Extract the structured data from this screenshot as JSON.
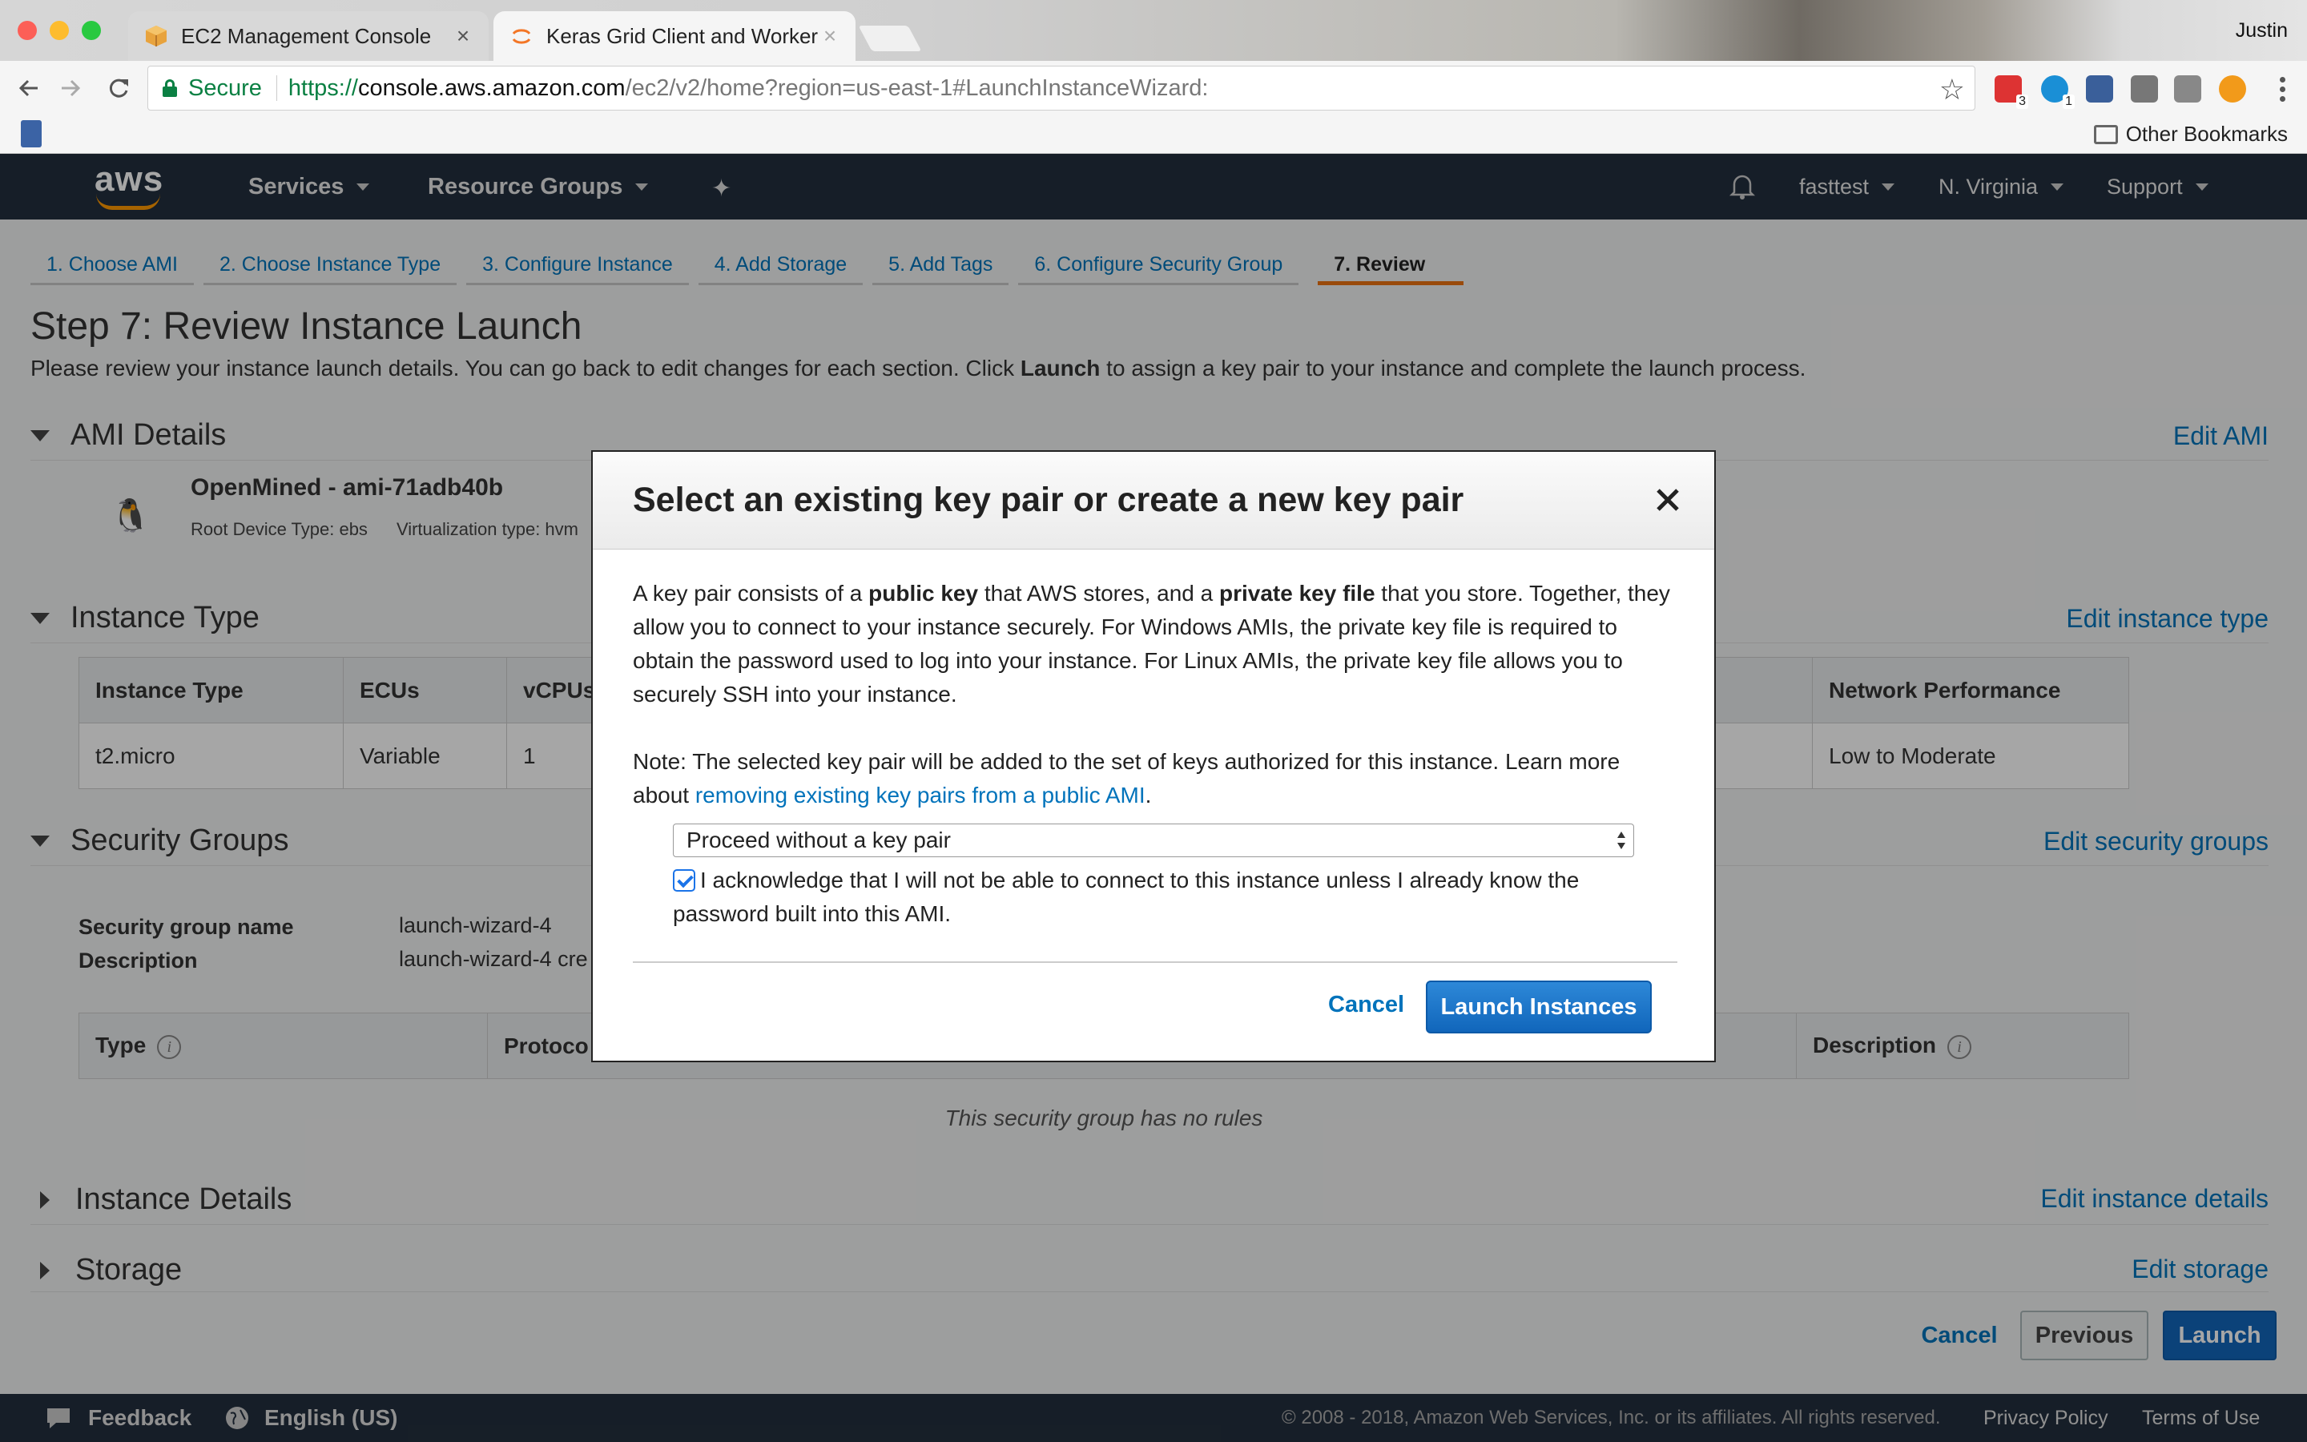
{
  "browser": {
    "tabs": [
      {
        "title": "EC2 Management Console",
        "active": false
      },
      {
        "title": "Keras Grid Client and Worker",
        "active": true
      }
    ],
    "profile_name": "Justin",
    "secure_label": "Secure",
    "url": {
      "scheme": "https://",
      "host": "console.aws.amazon.com",
      "path": "/ec2/v2/home?region=us-east-1#LaunchInstanceWizard:"
    },
    "extension_badges": [
      "3",
      "1"
    ],
    "other_bookmarks": "Other Bookmarks"
  },
  "aws_header": {
    "logo": "aws",
    "services": "Services",
    "resource_groups": "Resource Groups",
    "account": "fasttest",
    "region": "N. Virginia",
    "support": "Support"
  },
  "wizard": {
    "steps": [
      "1. Choose AMI",
      "2. Choose Instance Type",
      "3. Configure Instance",
      "4. Add Storage",
      "5. Add Tags",
      "6. Configure Security Group",
      "7. Review"
    ],
    "active_step": "7. Review",
    "title": "Step 7: Review Instance Launch",
    "description_prefix": "Please review your instance launch details. You can go back to edit changes for each section. Click ",
    "description_bold": "Launch",
    "description_suffix": " to assign a key pair to your instance and complete the launch process."
  },
  "ami_details": {
    "heading": "AMI Details",
    "edit": "Edit AMI",
    "name": "OpenMined - ami-71adb40b",
    "root_device": "Root Device Type: ebs",
    "virtualization": "Virtualization type: hvm"
  },
  "instance_type": {
    "heading": "Instance Type",
    "edit": "Edit instance type",
    "columns": [
      "Instance Type",
      "ECUs",
      "vCPUs",
      "Network Performance"
    ],
    "row": [
      "t2.micro",
      "Variable",
      "1",
      "Low to Moderate"
    ]
  },
  "security_groups": {
    "heading": "Security Groups",
    "edit": "Edit security groups",
    "name_label": "Security group name",
    "name_value": "launch-wizard-4",
    "desc_label": "Description",
    "desc_value": "launch-wizard-4 cre",
    "columns": [
      "Type",
      "Protoco",
      "Description"
    ],
    "empty": "This security group has no rules"
  },
  "instance_details": {
    "heading": "Instance Details",
    "edit": "Edit instance details"
  },
  "storage": {
    "heading": "Storage",
    "edit": "Edit storage"
  },
  "actions": {
    "cancel": "Cancel",
    "previous": "Previous",
    "launch": "Launch"
  },
  "footer": {
    "feedback": "Feedback",
    "language": "English (US)",
    "copyright": "© 2008 - 2018, Amazon Web Services, Inc. or its affiliates. All rights reserved.",
    "privacy": "Privacy Policy",
    "terms": "Terms of Use"
  },
  "modal": {
    "title": "Select an existing key pair or create a new key pair",
    "p1_a": "A key pair consists of a ",
    "p1_b": "public key",
    "p1_c": " that AWS stores, and a ",
    "p1_d": "private key file",
    "p1_e": " that you store. Together, they allow you to connect to your instance securely. For Windows AMIs, the private key file is required to obtain the password used to log into your instance. For Linux AMIs, the private key file allows you to securely SSH into your instance.",
    "p2_a": "Note: The selected key pair will be added to the set of keys authorized for this instance. Learn more about ",
    "p2_link": "removing existing key pairs from a public AMI",
    "p2_b": ".",
    "select_value": "Proceed without a key pair",
    "acknowledge": "I acknowledge that I will not be able to connect to this instance unless I already know the password built into this AMI.",
    "acknowledge_checked": true,
    "cancel": "Cancel",
    "launch": "Launch Instances"
  },
  "colors": {
    "aws_nav": "#232f3e",
    "link": "#0073bb",
    "active_step_underline": "#ec7211",
    "primary_button": "#1166bb"
  }
}
